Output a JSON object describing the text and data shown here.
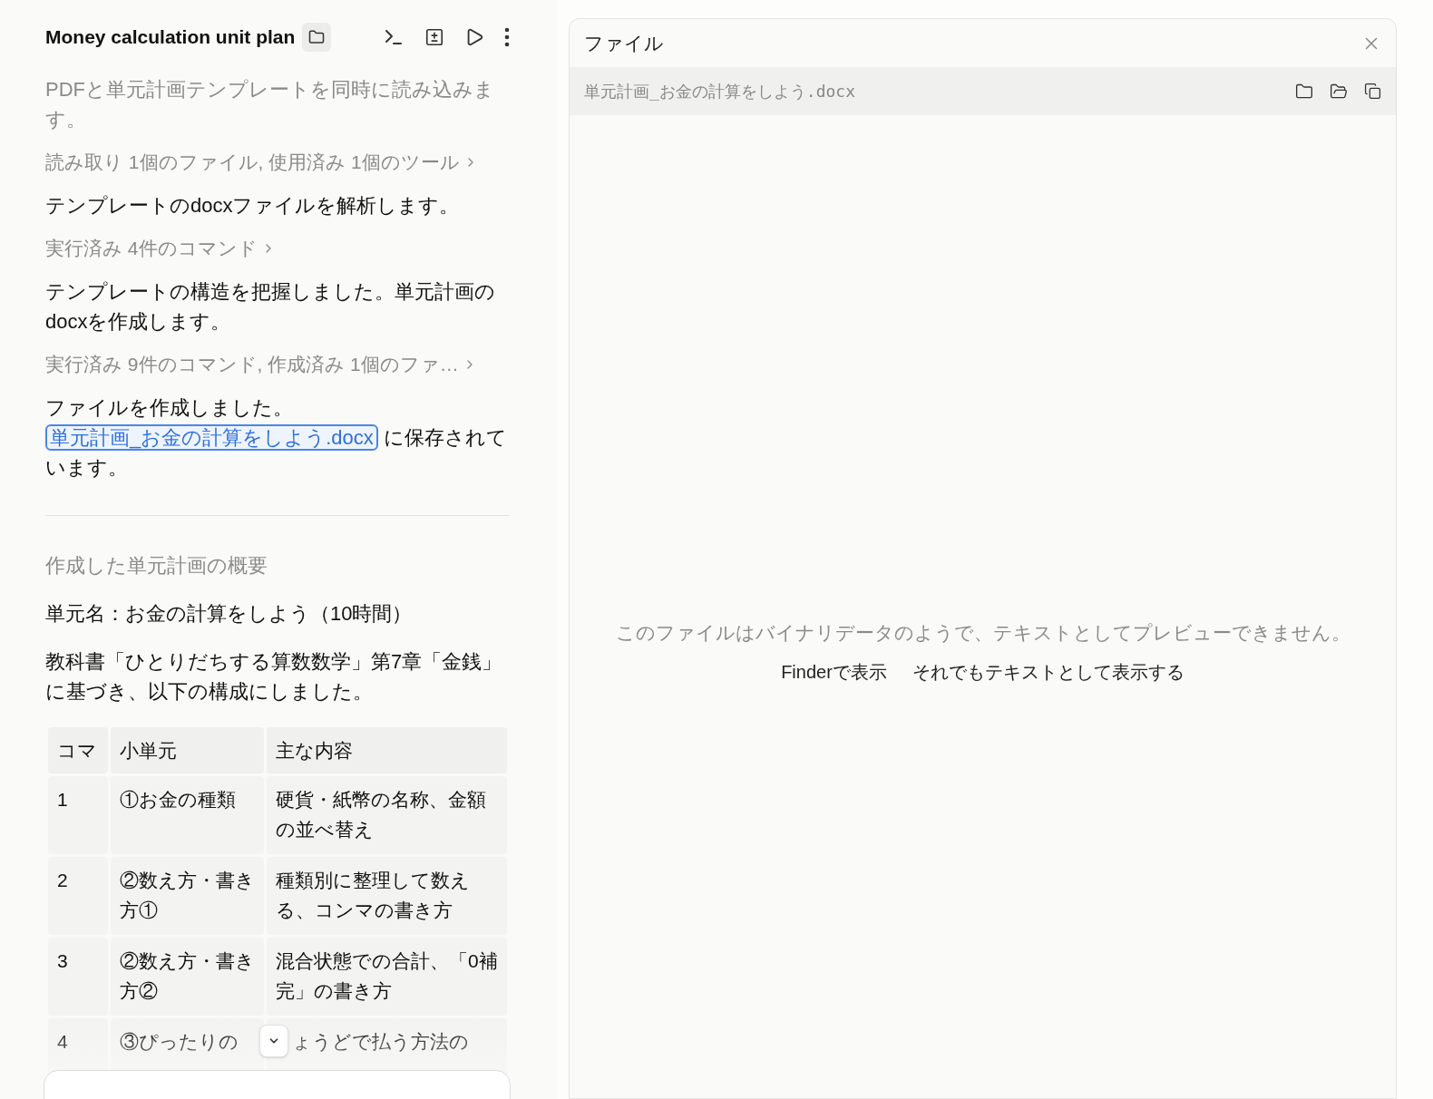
{
  "header": {
    "title": "Money calculation unit plan"
  },
  "messages": [
    {
      "kind": "status",
      "text": "PDFと単元計画テンプレートを同時に読み込みます。"
    },
    {
      "kind": "tool_summary",
      "text": "読み取り 1個のファイル, 使用済み 1個のツール"
    },
    {
      "kind": "text",
      "text": "テンプレートのdocxファイルを解析します。"
    },
    {
      "kind": "tool_summary",
      "text": "実行済み 4件のコマンド"
    },
    {
      "kind": "text",
      "text": "テンプレートの構造を把握しました。単元計画のdocxを作成します。"
    },
    {
      "kind": "tool_summary",
      "text": "実行済み 9件のコマンド, 作成済み 1個のファ…"
    },
    {
      "kind": "link_text",
      "before": "ファイルを作成しました。",
      "link": "単元計画_お金の計算をしよう.docx",
      "after": "に保存されています。"
    }
  ],
  "summary": {
    "heading": "作成した単元計画の概要",
    "unit_name": "単元名：お金の計算をしよう（10時間）",
    "description": "教科書「ひとりだちする算数数学」第7章「金銭」に基づき、以下の構成にしました。",
    "table": {
      "columns": [
        "コマ",
        "小単元",
        "主な内容"
      ],
      "rows": [
        [
          "1",
          "①お金の種類",
          "硬貨・紙幣の名称、金額の並べ替え"
        ],
        [
          "2",
          "②数え方・書き方①",
          "種類別に整理して数える、コンマの書き方"
        ],
        [
          "3",
          "②数え方・書き方②",
          "混合状態での合計、「0補完」の書き方"
        ],
        [
          "4",
          "③ぴったりの",
          "ょうどで払う方法の"
        ]
      ]
    }
  },
  "file_panel": {
    "title": "ファイル",
    "path": "単元計画_お金の計算をしよう.docx",
    "message": "このファイルはバイナリデータのようで、テキストとしてプレビューできません。",
    "actions": [
      "Finderで表示",
      "それでもテキストとして表示する"
    ]
  }
}
